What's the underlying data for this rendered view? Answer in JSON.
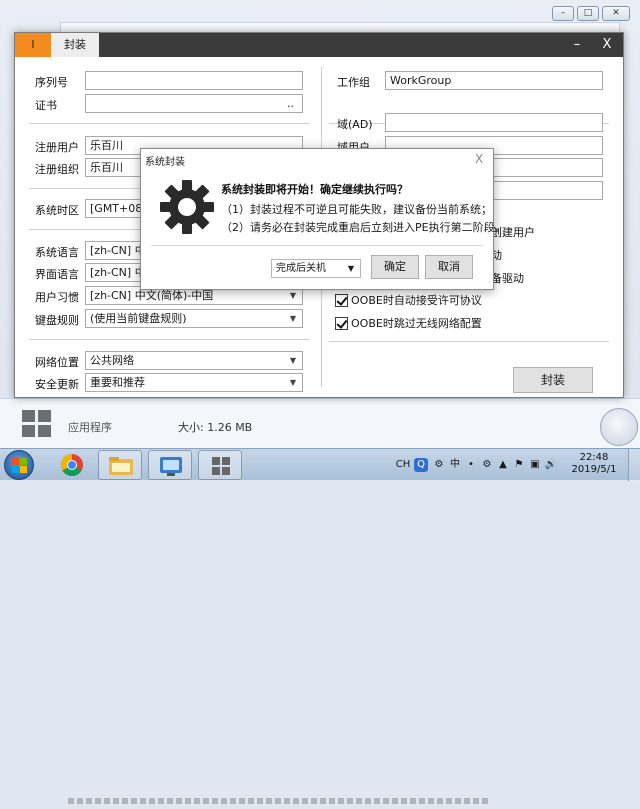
{
  "background_window": {
    "file_type_label": "应用程序",
    "file_size_label": "大小: 1.26 MB"
  },
  "app": {
    "logo_text": "I",
    "tab_label": "封装",
    "minimize_label": "–",
    "close_label": "X"
  },
  "form": {
    "serial_label": "序列号",
    "serial_value": "",
    "cert_label": "证书",
    "cert_value": "",
    "cert_browse": "..",
    "reg_user_label": "注册用户",
    "reg_user_value": "乐百川",
    "reg_org_label": "注册组织",
    "reg_org_value": "乐百川",
    "timezone_label": "系统时区",
    "timezone_value": "[GMT+08:0",
    "sys_lang_label": "系统语言",
    "sys_lang_value": "[zh-CN] 中文",
    "ui_lang_label": "界面语言",
    "ui_lang_value": "[zh-CN] 中文",
    "user_habit_label": "用户习惯",
    "user_habit_value": "[zh-CN] 中文(简体)-中国",
    "keyboard_label": "键盘规则",
    "keyboard_value": "(使用当前键盘规则)",
    "net_location_label": "网络位置",
    "net_location_value": "公共网络",
    "security_update_label": "安全更新",
    "security_update_value": "重要和推荐",
    "workgroup_label": "工作组",
    "workgroup_value": "WorkGroup",
    "domain_label": "域(AD)",
    "domain_value": "",
    "domain_user_label": "域用户",
    "domain_user_value": "",
    "option_create_user": "创建用户",
    "option_auto_start": "动",
    "option_backup_driver": "备驱动",
    "option_oobe_license": "OOBE时自动接受许可协议",
    "option_oobe_wireless": "OOBE时跳过无线网络配置",
    "package_button": "封装"
  },
  "dialog": {
    "title": "系统封装",
    "close": "X",
    "headline": "系统封装即将开始！确定继续执行吗？",
    "line1": "（1）封装过程不可逆且可能失败，建议备份当前系统；",
    "line2": "（2）请务必在封装完成重启后立刻进入PE执行第二阶段。",
    "after_action_value": "完成后关机",
    "confirm_label": "确定",
    "cancel_label": "取消"
  },
  "taskbar": {
    "ime_label": "CH",
    "clock_time": "22:48",
    "clock_date": "2019/5/1"
  },
  "icons": [
    "windows-start-icon",
    "chrome-icon",
    "explorer-folder-icon",
    "control-panel-icon",
    "app-tiles-icon",
    "gear-icon",
    "robot-assistant-icon"
  ],
  "colors": {
    "accent_orange": "#f28c1f",
    "titlebar_dark": "#3b3b3b",
    "taskbar_blue": "#a9c0d8"
  }
}
